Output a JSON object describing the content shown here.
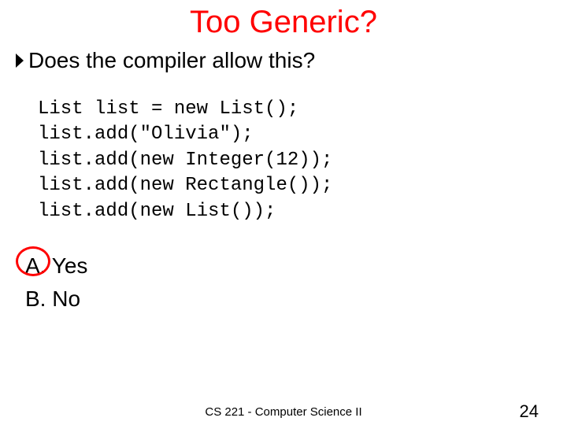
{
  "title": "Too Generic?",
  "bullet": "Does the compiler allow this?",
  "code": "List list = new List();\nlist.add(\"Olivia\");\nlist.add(new Integer(12));\nlist.add(new Rectangle());\nlist.add(new List());",
  "options": {
    "a": "A. Yes",
    "b": "B. No"
  },
  "circled_option": "a",
  "footer": "CS 221 - Computer Science II",
  "page_number": "24"
}
